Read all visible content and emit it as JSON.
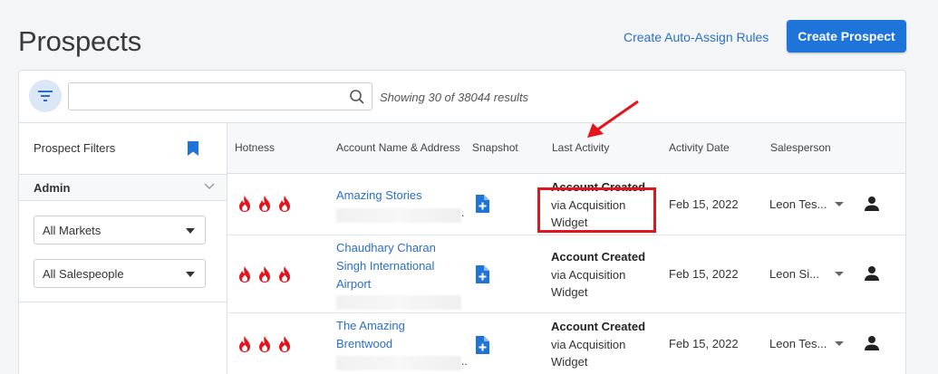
{
  "header": {
    "title": "Prospects",
    "auto_assign_link": "Create Auto-Assign Rules",
    "create_button": "Create Prospect"
  },
  "toolbar": {
    "search_value": "",
    "results_text": "Showing 30 of 38044 results"
  },
  "sidebar": {
    "title": "Prospect Filters",
    "section_label": "Admin",
    "market_select": "All Markets",
    "salespeople_select": "All Salespeople"
  },
  "table": {
    "columns": [
      "Hotness",
      "Account Name & Address",
      "Snapshot",
      "Last Activity",
      "Activity Date",
      "Salesperson"
    ],
    "rows": [
      {
        "hotness": 3,
        "account_name": "Amazing Stories",
        "activity_title": "Account Created",
        "activity_detail": "via Acquisition Widget",
        "date": "Feb 15, 2022",
        "salesperson": "Leon Tes..."
      },
      {
        "hotness": 3,
        "account_name": "Chaudhary Charan Singh International Airport",
        "activity_title": "Account Created",
        "activity_detail": "via Acquisition Widget",
        "date": "Feb 15, 2022",
        "salesperson": "Leon Si..."
      },
      {
        "hotness": 3,
        "account_name": "The Amazing Brentwood",
        "activity_title": "Account Created",
        "activity_detail": "via Acquisition Widget",
        "date": "Feb 15, 2022",
        "salesperson": "Leon Tes..."
      }
    ]
  },
  "colors": {
    "accent": "#1f74d9",
    "link": "#2a6fc9",
    "fire": "#e3141c",
    "annotation": "#e3141c"
  },
  "icons": [
    "filter-icon",
    "search-icon",
    "bookmark-icon",
    "chevron-down-icon",
    "fire-icon",
    "document-plus-icon",
    "person-icon",
    "caret-down-icon"
  ]
}
